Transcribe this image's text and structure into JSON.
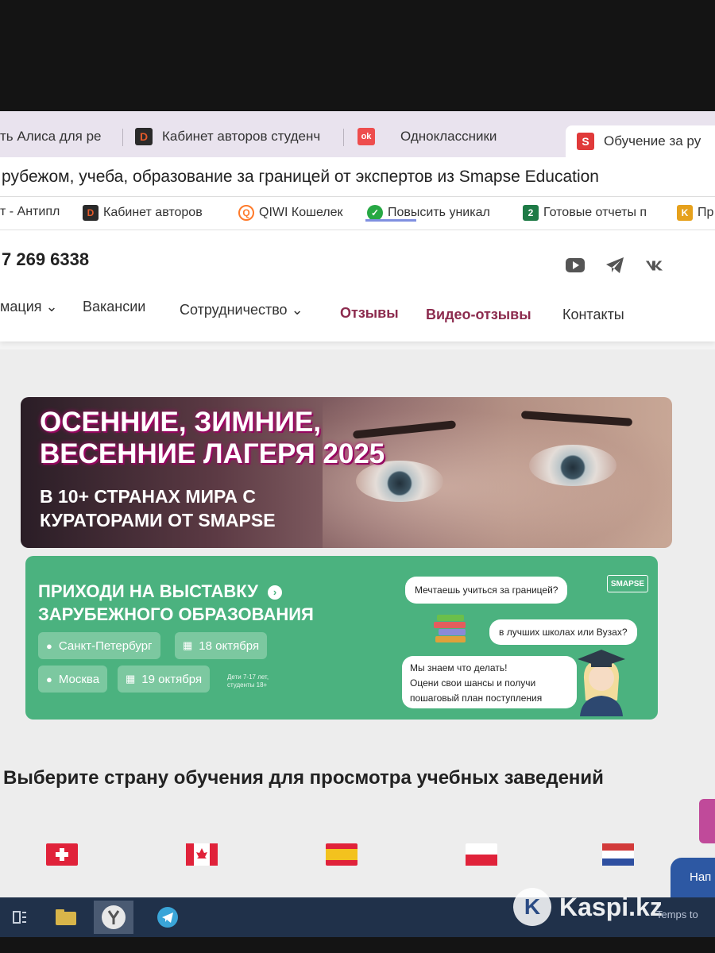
{
  "browser": {
    "tabs": [
      {
        "label": "ть Алиса для ре",
        "icon": ""
      },
      {
        "label": "Кабинет авторов студенч",
        "icon": "D",
        "color": "#e45a2a"
      },
      {
        "label": "Одноклассники",
        "icon": "ok",
        "color": "#ee4d4d"
      },
      {
        "label": "Обучение за ру",
        "icon": "S",
        "color": "#e03a3a"
      }
    ],
    "page_title": "рубежом, учеба, образование за границей от экспертов из Smapse Education",
    "bookmarks": [
      {
        "label": "т - Антипл"
      },
      {
        "label": "Кабинет авторов",
        "icon": "D",
        "color": "#e45a2a"
      },
      {
        "label": "QIWI Кошелек",
        "icon": "Q",
        "color": "#ff7a2a"
      },
      {
        "label": "Повысить уникал",
        "icon": "✓",
        "color": "#27a844"
      },
      {
        "label": "Готовые отчеты п",
        "icon": "2",
        "color": "#1e7a46"
      },
      {
        "label": "Пр",
        "icon": "K",
        "color": "#e6a11c"
      }
    ]
  },
  "site": {
    "phone": "7 269 6338",
    "social_icons": [
      "youtube-icon",
      "telegram-icon",
      "vk-icon"
    ],
    "nav": [
      {
        "label": "мация",
        "dropdown": true
      },
      {
        "label": "Вакансии"
      },
      {
        "label": "Сотрудничество",
        "dropdown": true
      },
      {
        "label": "Отзывы",
        "highlight": true
      },
      {
        "label": "Видео-отзывы",
        "highlight": true
      },
      {
        "label": "Контакты"
      }
    ],
    "dropdown_glyph": "⌄",
    "hero": {
      "title_line1": "ОСЕННИЕ, ЗИМНИЕ,",
      "title_line2": "ВЕСЕННИЕ ЛАГЕРЯ 2025",
      "sub_line1": "В 10+ СТРАНАХ МИРА С",
      "sub_line2": "КУРАТОРАМИ ОТ SMAPSE"
    },
    "expo": {
      "title_line1": "ПРИХОДИ НА ВЫСТАВКУ",
      "title_line2": "ЗАРУБЕЖНОГО ОБРАЗОВАНИЯ",
      "arrow": "›",
      "city1": "Санкт-Петербург",
      "date1": "18 октября",
      "city2": "Москва",
      "date2": "19 октября",
      "age_note": "Дети 7-17 лет, студенты 18+",
      "bubble1": "Мечтаешь учиться за границей?",
      "bubble2": "в лучших школах или Вузах?",
      "bubble3_line1": "Мы знаем что делать!",
      "bubble3_line2": "Оцени свои шансы и получи",
      "bubble3_line3": "пошаговый план поступления",
      "logo": "SMAPSE",
      "accent": "#4bb27f"
    },
    "section_title": "Выберите страну обучения для просмотра учебных заведений",
    "chat_label": "Нап"
  },
  "watermark": "Kaspi.kz",
  "taskbar_tip": "Temps to"
}
